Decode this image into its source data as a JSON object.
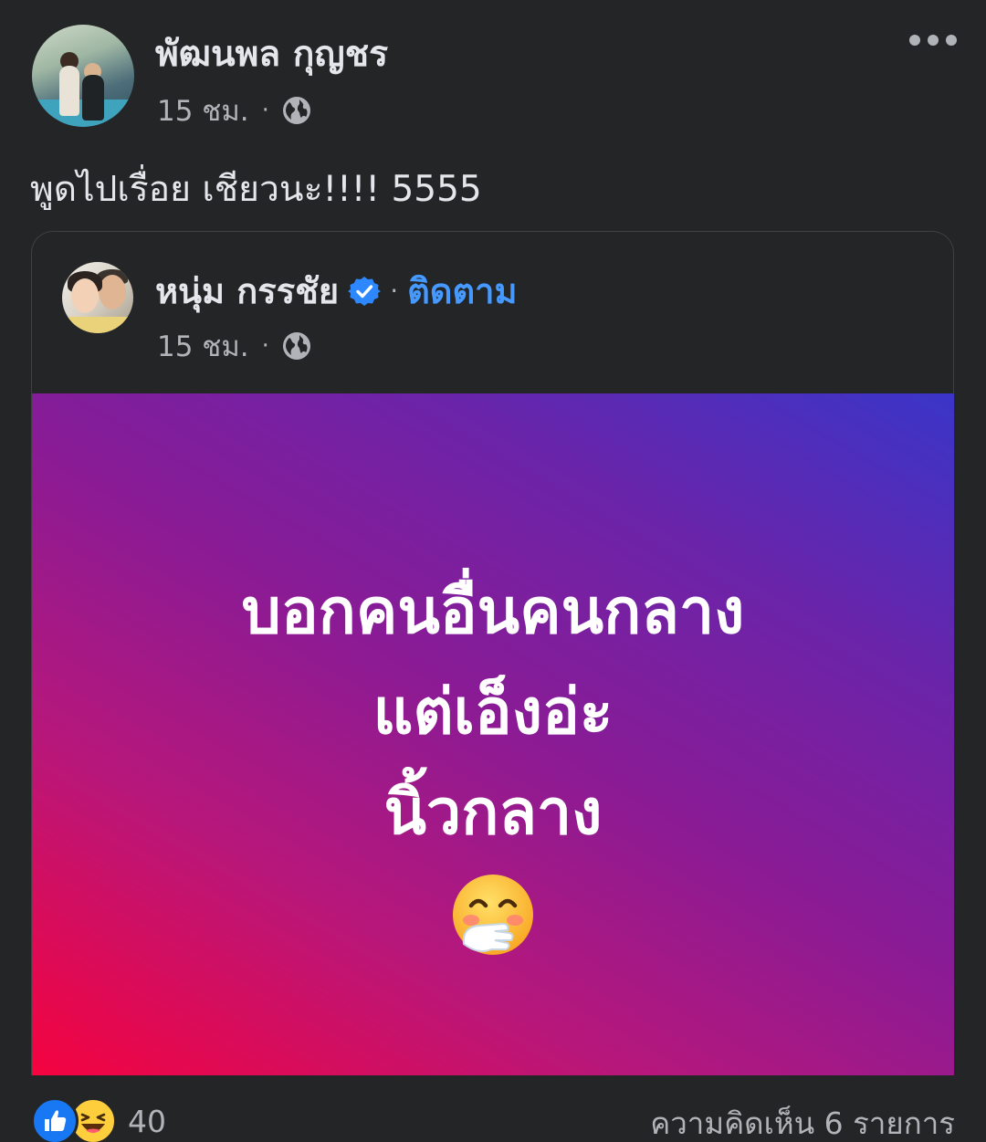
{
  "post": {
    "author_name": "พัฒนพล กุญชร",
    "time": "15 ชม.",
    "privacy_icon": "globe-icon",
    "more_icon": "more-options-icon",
    "text": "พูดไปเรื่อย เชียวนะ!!!! 5555"
  },
  "shared_post": {
    "author_name": "หนุ่ม กรรชัย",
    "verified_icon": "verified-badge-icon",
    "separator": "·",
    "follow_label": "ติดตาม",
    "time": "15 ชม.",
    "privacy_icon": "globe-icon",
    "banner": {
      "line1": "บอกคนอื่นคนกลาง",
      "line2": "แต่เอ็งอ่ะ",
      "line3": "นิ้วกลาง",
      "emoji": "face-with-hand-over-mouth-emoji",
      "gradient_colors": [
        "#f5033f",
        "#8a1b95",
        "#3a35c8"
      ]
    }
  },
  "footer": {
    "reaction_icons": [
      "like-icon",
      "haha-icon"
    ],
    "reaction_count": "40",
    "comments_label": "ความคิดเห็น 6 รายการ"
  },
  "colors": {
    "background": "#242526",
    "text_primary": "#e4e6eb",
    "text_secondary": "#b0b3b8",
    "link_blue": "#4599ff",
    "like_blue": "#1877f2"
  }
}
